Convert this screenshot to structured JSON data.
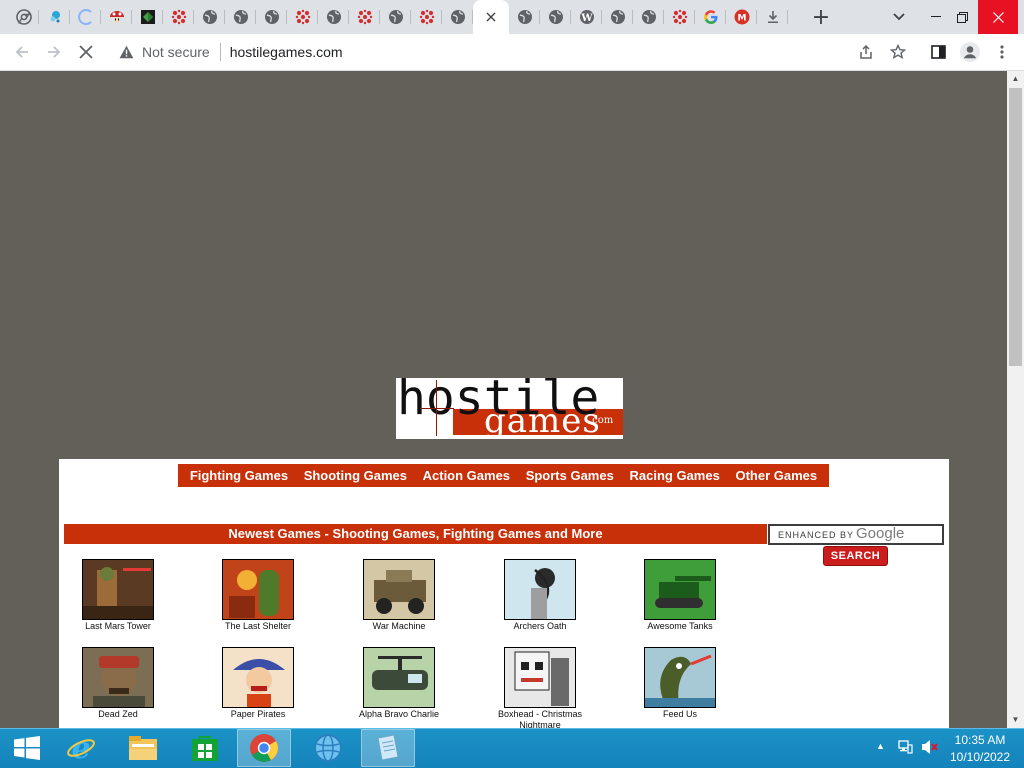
{
  "browser": {
    "tabs": [
      {
        "icon": "chrome-icon",
        "color": "#5f6368"
      },
      {
        "icon": "tab-favicon-blue-leaf",
        "color": "#2aa6d6"
      },
      {
        "icon": "loading-spinner-icon",
        "color": "#8ab4f8"
      },
      {
        "icon": "mushroom-icon",
        "color": "#c62828"
      },
      {
        "icon": "green-cube-icon",
        "color": "#2e7d32"
      },
      {
        "icon": "red-dots-icon",
        "color": "#d32f2f"
      },
      {
        "icon": "globe-icon",
        "color": "#5f6368"
      },
      {
        "icon": "globe-icon",
        "color": "#5f6368"
      },
      {
        "icon": "globe-icon",
        "color": "#5f6368"
      },
      {
        "icon": "red-dots-icon",
        "color": "#d32f2f"
      },
      {
        "icon": "globe-icon",
        "color": "#5f6368"
      },
      {
        "icon": "red-dots-icon",
        "color": "#d32f2f"
      },
      {
        "icon": "globe-icon",
        "color": "#5f6368"
      },
      {
        "icon": "red-dots-icon",
        "color": "#d32f2f"
      },
      {
        "icon": "globe-icon",
        "color": "#5f6368"
      },
      {
        "icon": "close-icon",
        "color": "#3c4043",
        "active": true
      },
      {
        "icon": "globe-icon",
        "color": "#5f6368"
      },
      {
        "icon": "globe-icon",
        "color": "#5f6368"
      },
      {
        "icon": "wordpress-icon",
        "color": "#5f6368"
      },
      {
        "icon": "globe-icon",
        "color": "#5f6368"
      },
      {
        "icon": "globe-icon",
        "color": "#5f6368"
      },
      {
        "icon": "red-dots-icon",
        "color": "#d32f2f"
      },
      {
        "icon": "google-icon",
        "color": "#4285f4"
      },
      {
        "icon": "gmail-m-icon",
        "color": "#d93025"
      },
      {
        "icon": "download-icon",
        "color": "#5f6368"
      }
    ],
    "new_tab_glyph": "+",
    "address": {
      "security_label": "Not secure",
      "url": "hostilegames.com"
    }
  },
  "page": {
    "logo": {
      "word1": "hostile",
      "word2": "games",
      "tld": ".com"
    },
    "nav": [
      "Fighting Games",
      "Shooting Games",
      "Action Games",
      "Sports Games",
      "Racing Games",
      "Other Games"
    ],
    "section_title": "Newest Games - Shooting Games, Fighting Games and More",
    "search": {
      "enhanced_by": "ENHANCED BY",
      "google": "Google",
      "button": "SEARCH"
    },
    "games": [
      {
        "name": "Last Mars Tower",
        "bg": "#5a3a22",
        "fg": "#9b6b3a"
      },
      {
        "name": "The Last Shelter",
        "bg": "#c0431a",
        "fg": "#4f7a2a"
      },
      {
        "name": "War Machine",
        "bg": "#d4c7a6",
        "fg": "#6b5b3a"
      },
      {
        "name": "Archers Oath",
        "bg": "#cfe6ef",
        "fg": "#2a2a2a"
      },
      {
        "name": "Awesome Tanks",
        "bg": "#3f9e3a",
        "fg": "#1c5c1a"
      },
      {
        "name": "Dead Zed",
        "bg": "#7b6e54",
        "fg": "#b33a2a"
      },
      {
        "name": "Paper Pirates",
        "bg": "#f5e1c8",
        "fg": "#3b4ea8"
      },
      {
        "name": "Alpha Bravo Charlie",
        "bg": "#b9d3a8",
        "fg": "#3c4a3a"
      },
      {
        "name": "Boxhead - Christmas Nightmare",
        "bg": "#e8e8e8",
        "fg": "#c0392b"
      },
      {
        "name": "Feed Us",
        "bg": "#a7c9d6",
        "fg": "#4b5e2a"
      }
    ]
  },
  "taskbar": {
    "items": [
      "start-icon",
      "internet-explorer-icon",
      "file-explorer-icon",
      "store-icon",
      "chrome-icon",
      "globe-blue-icon",
      "notepad-icon"
    ],
    "clock_time": "10:35 AM",
    "clock_date": "10/10/2022"
  }
}
